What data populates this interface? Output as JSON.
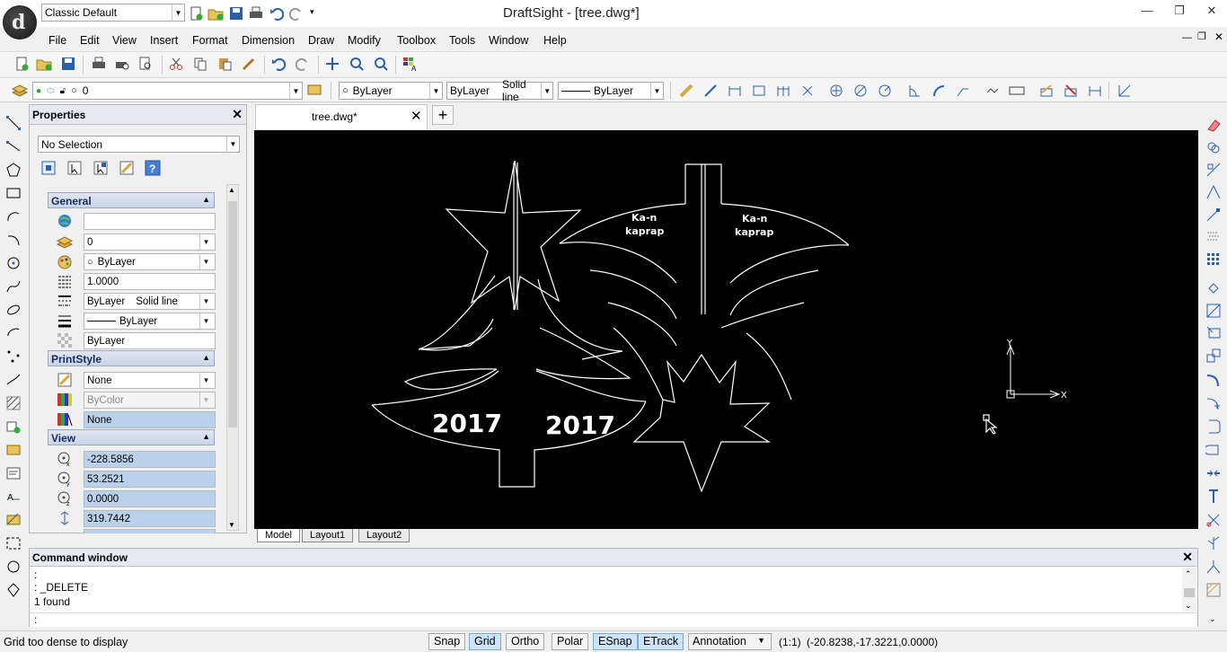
{
  "titlebar": {
    "workspace": "Classic Default",
    "app_title": "DraftSight - [tree.dwg*]",
    "logo_letter": "d"
  },
  "menu": [
    "File",
    "Edit",
    "View",
    "Insert",
    "Format",
    "Dimension",
    "Draw",
    "Modify",
    "Toolbox",
    "Tools",
    "Window",
    "Help"
  ],
  "layer_toolbar": {
    "layer": "0",
    "color": "ByLayer",
    "linetype_prefix": "ByLayer",
    "linetype": "Solid line",
    "lineweight": "ByLayer"
  },
  "properties": {
    "title": "Properties",
    "selection": "No Selection",
    "sections": {
      "general": "General",
      "printstyle": "PrintStyle",
      "view": "View"
    },
    "general": {
      "color_field": "",
      "layer": "0",
      "color": "ByLayer",
      "scale": "1.0000",
      "linetype_prefix": "ByLayer",
      "linetype": "Solid line",
      "lineweight": "ByLayer",
      "transparency": "ByLayer"
    },
    "printstyle": {
      "style": "None",
      "table": "ByColor",
      "attached": "None"
    },
    "view": {
      "center_x": "-228.5856",
      "center_y": "53.2521",
      "center_z": "0.0000",
      "height": "319.7442"
    }
  },
  "document": {
    "tab": "tree.dwg*",
    "new_tab_symbol": "+",
    "drawing_text": {
      "year_left": "2017",
      "year_right": "2017",
      "bird_text_line1": "Ka-n",
      "bird_text_line2": "kaprap"
    },
    "ucs_x": "X",
    "ucs_y": "Y"
  },
  "layout_tabs": [
    "Model",
    "Layout1",
    "Layout2"
  ],
  "command": {
    "title": "Command window",
    "lines": [
      ":",
      ": _DELETE",
      "1 found",
      ":"
    ]
  },
  "status": {
    "message": "Grid too dense to display",
    "buttons": [
      {
        "label": "Snap",
        "on": false
      },
      {
        "label": "Grid",
        "on": true
      },
      {
        "label": "Ortho",
        "on": false
      },
      {
        "label": "Polar",
        "on": false
      },
      {
        "label": "ESnap",
        "on": true
      },
      {
        "label": "ETrack",
        "on": true
      }
    ],
    "annotation": "Annotation",
    "scale": "(1:1)",
    "coords": "(-20.8238,-17.3221,0.0000)"
  },
  "colors": {
    "accent": "#1f5fae",
    "canvas": "#000000",
    "drawing_stroke": "#ffffff",
    "selected_field": "#b9d1ea"
  }
}
